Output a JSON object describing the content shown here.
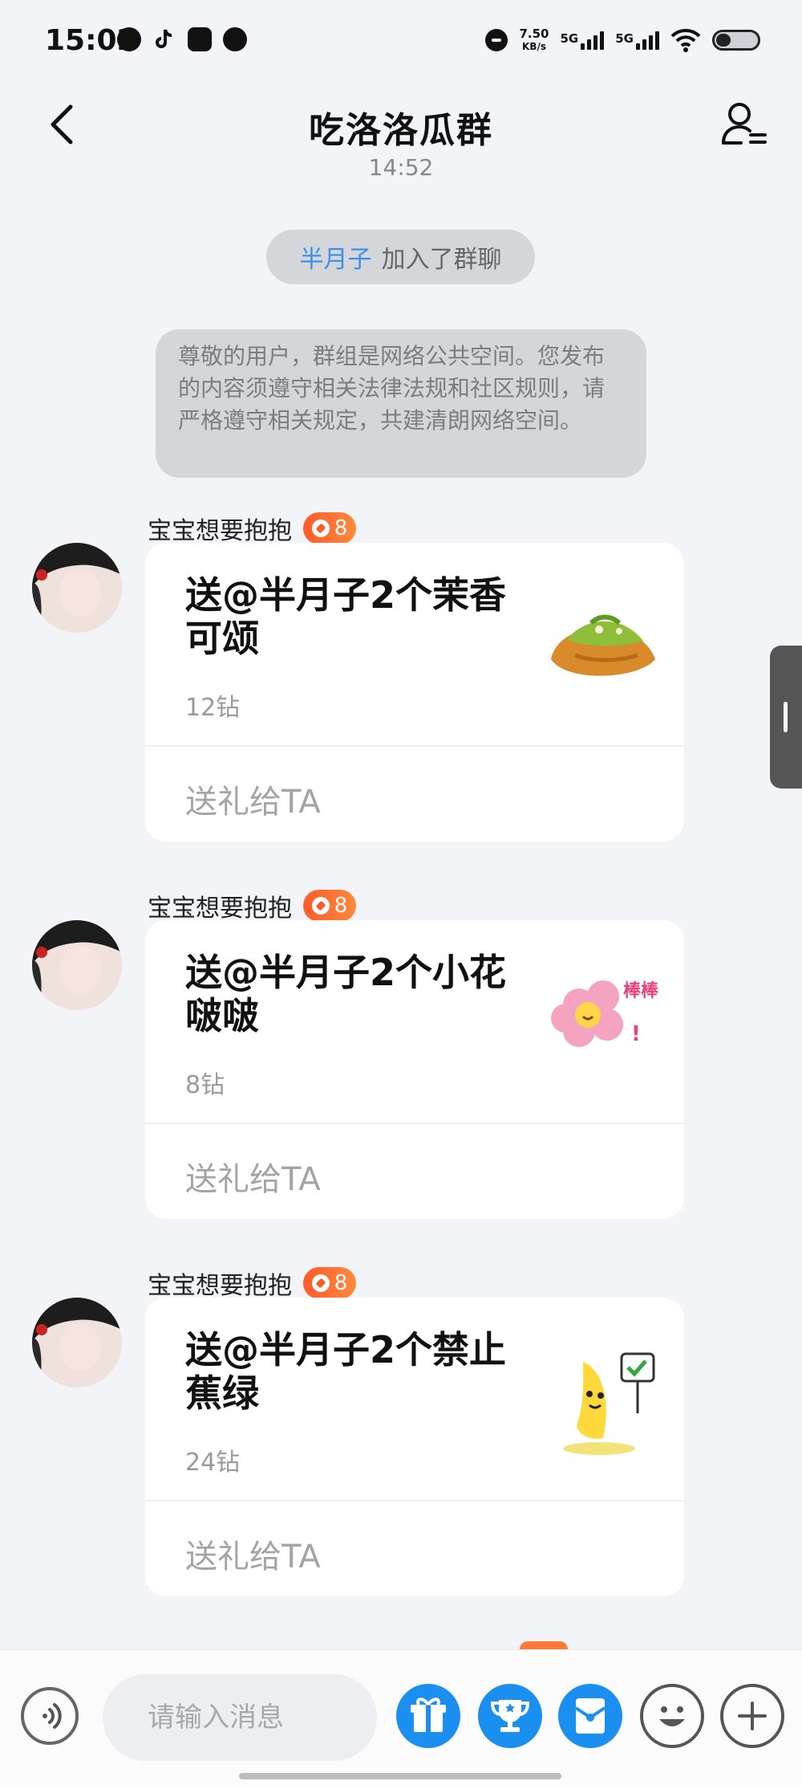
{
  "status_bar": {
    "time": "15:02",
    "net_speed_value": "7.50",
    "net_speed_unit": "KB/s",
    "sim1_label": "5G",
    "sim2_label": "5G"
  },
  "header": {
    "title": "吃洛洛瓜群"
  },
  "chat": {
    "timestamp": "14:52",
    "join_notice": {
      "user": "半月子",
      "text": "加入了群聊"
    },
    "system_notice": "尊敬的用户，群组是网络公共空间。您发布的内容须遵守相关法律法规和社区规则，请严格遵守相关规定，共建清朗网络空间。",
    "messages": [
      {
        "sender": "宝宝想要抱抱",
        "level": "8",
        "gift_text": "送@半月子2个茉香可颂",
        "price": "12钻",
        "action": "送礼给TA",
        "gift_icon": "croissant-gift-icon"
      },
      {
        "sender": "宝宝想要抱抱",
        "level": "8",
        "gift_text": "送@半月子2个小花啵啵",
        "price": "8钻",
        "action": "送礼给TA",
        "gift_icon": "flower-gift-icon",
        "gift_sticker_text": "棒棒"
      },
      {
        "sender": "宝宝想要抱抱",
        "level": "8",
        "gift_text": "送@半月子2个禁止蕉绿",
        "price": "24钻",
        "action": "送礼给TA",
        "gift_icon": "banana-gift-icon"
      }
    ]
  },
  "input_bar": {
    "placeholder": "请输入消息",
    "icons": [
      "voice-icon",
      "gift-icon",
      "trophy-icon",
      "red-packet-icon",
      "emoji-icon",
      "plus-icon"
    ]
  },
  "colors": {
    "background": "#f2f4f7",
    "accent_blue": "#1a8ff0",
    "level_badge": "#ff5b2a",
    "mention_blue": "#3a8ff0"
  }
}
